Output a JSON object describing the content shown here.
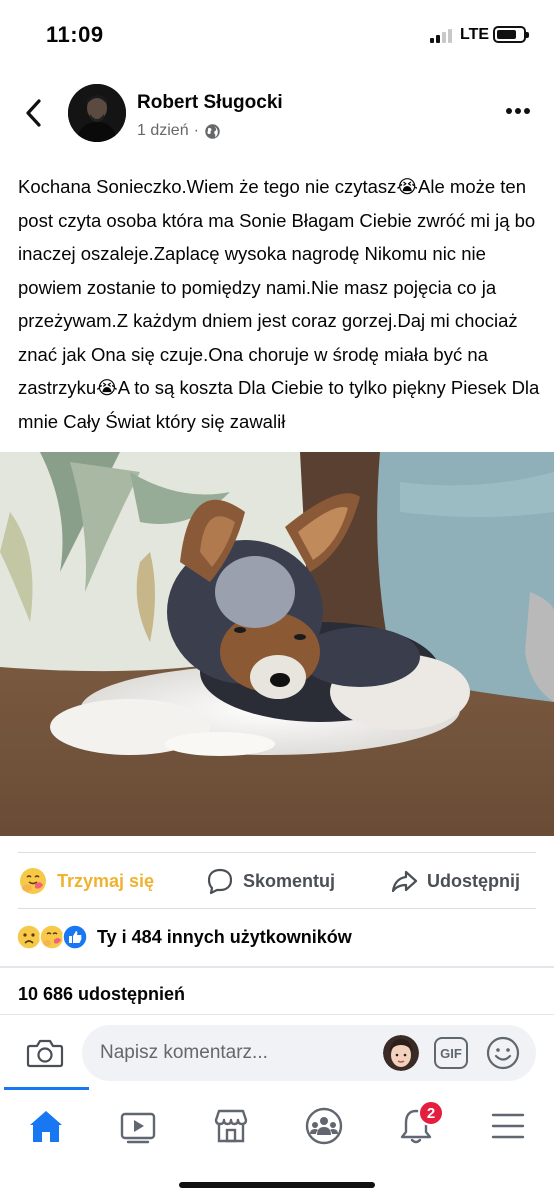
{
  "status_bar": {
    "time": "11:09",
    "network": "LTE",
    "battery_level": 0.75
  },
  "post": {
    "author": "Robert Sługocki",
    "time_ago": "1 dzień",
    "separator": "·",
    "privacy_icon": "globe-icon",
    "text": "Kochana Sonieczko.Wiem że tego nie czytasz😭Ale może ten post czyta osoba która ma Sonie Błagam Ciebie zwróć mi ją bo inaczej oszaleje.Zaplacę wysoka nagrodę Nikomu nic nie powiem zostanie to pomiędzy nami.Nie masz pojęcia co ja przeżywam.Z każdym dniem jest coraz gorzej.Daj mi chociaż znać jak Ona się czuje.Ona choruje w środę miała być na zastrzyku😭A to są koszta Dla Ciebie to tylko piękny Piesek Dla mnie Cały Świat który się zawalił"
  },
  "actions": {
    "react_label": "Trzymaj się",
    "comment_label": "Skomentuj",
    "share_label": "Udostępnij",
    "active_color": "#f0b330"
  },
  "reactions": {
    "icons": [
      "sad-emoji-icon",
      "care-emoji-icon",
      "like-icon"
    ],
    "summary": "Ty i 484 innych użytkowników"
  },
  "shares": {
    "text": "10 686 udostępnień"
  },
  "comment_bar": {
    "placeholder": "Napisz komentarz...",
    "gif_label": "GIF"
  },
  "bottom_nav": {
    "items": [
      "home-icon",
      "watch-icon",
      "marketplace-icon",
      "groups-icon",
      "notifications-icon",
      "menu-icon"
    ],
    "notification_count": "2",
    "accent": "#1877f2"
  }
}
